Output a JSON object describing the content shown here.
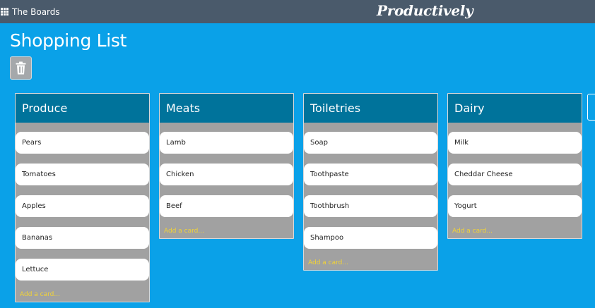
{
  "topbar": {
    "boards_label": "The Boards",
    "brand": "Productively",
    "boards_icon": "grid-icon"
  },
  "board": {
    "title": "Shopping List",
    "delete_icon": "trash-icon"
  },
  "lists": [
    {
      "title": "Produce",
      "cards": [
        "Pears",
        "Tomatoes",
        "Apples",
        "Bananas",
        "Lettuce"
      ],
      "add_card": "Add a card..."
    },
    {
      "title": "Meats",
      "cards": [
        "Lamb",
        "Chicken",
        "Beef"
      ],
      "add_card": "Add a card..."
    },
    {
      "title": "Toiletries",
      "cards": [
        "Soap",
        "Toothpaste",
        "Toothbrush",
        "Shampoo"
      ],
      "add_card": "Add a card..."
    },
    {
      "title": "Dairy",
      "cards": [
        "Milk",
        "Cheddar Cheese",
        "Yogurt"
      ],
      "add_card": "Add a card..."
    }
  ],
  "colors": {
    "background": "#0aa1e8",
    "topbar": "#4a5a6b",
    "list_header": "#00739b",
    "list_body": "#a1a1a1",
    "add_card_text": "#f2d337"
  }
}
